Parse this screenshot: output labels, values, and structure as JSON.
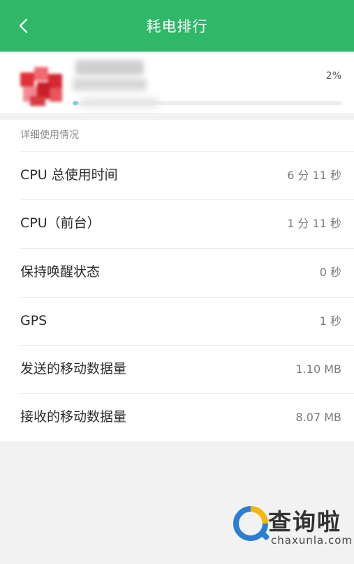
{
  "header": {
    "title": "耗电排行",
    "back_icon": "chevron-left-icon"
  },
  "app": {
    "percent": "2%",
    "usage_fraction": 0.02
  },
  "details": {
    "heading": "详细使用情况",
    "rows": [
      {
        "label": "CPU 总使用时间",
        "value": "6 分 11 秒"
      },
      {
        "label": "CPU（前台）",
        "value": "1 分 11 秒"
      },
      {
        "label": "保持唤醒状态",
        "value": "0 秒"
      },
      {
        "label": "GPS",
        "value": "1 秒"
      },
      {
        "label": "发送的移动数据量",
        "value": "1.10 MB"
      },
      {
        "label": "接收的移动数据量",
        "value": "8.07 MB"
      }
    ]
  },
  "watermark": {
    "text": "查询啦",
    "domain": "chaxunla.com"
  },
  "colors": {
    "header": "#2eb868",
    "progress": "#7cc4ea",
    "watermark_blue": "#2a7fd4",
    "watermark_yellow": "#f5b800"
  }
}
